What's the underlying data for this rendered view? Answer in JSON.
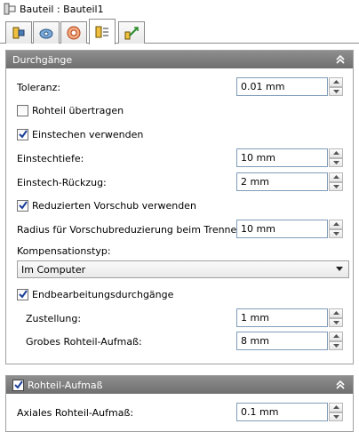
{
  "window": {
    "title": "Bauteil : Bauteil1"
  },
  "tabs": [
    {
      "icon": "tool-icon"
    },
    {
      "icon": "tool-holder-icon"
    },
    {
      "icon": "feed-speed-icon"
    },
    {
      "icon": "passes-icon",
      "active": true
    },
    {
      "icon": "linking-icon"
    }
  ],
  "passes_panel": {
    "header": "Durchgänge",
    "tolerance": {
      "label": "Toleranz:",
      "value": "0.01 mm"
    },
    "transfer_stock": {
      "label": "Rohteil übertragen",
      "checked": false
    },
    "use_plunge": {
      "label": "Einstechen verwenden",
      "checked": true
    },
    "plunge_depth": {
      "label": "Einstechtiefe:",
      "value": "10 mm"
    },
    "plunge_retract": {
      "label": "Einstech-Rückzug:",
      "value": "2 mm"
    },
    "reduced_feed": {
      "label": "Reduzierten Vorschub verwenden",
      "checked": true
    },
    "reduced_feed_radius": {
      "label": "Radius für Vorschubreduzierung beim Trennen:",
      "value": "10 mm"
    },
    "compensation": {
      "label": "Kompensationstyp:",
      "value": "Im Computer"
    },
    "finishing_passes": {
      "label": "Endbearbeitungsdurchgänge",
      "checked": true
    },
    "stepover": {
      "label": "Zustellung:",
      "value": "1 mm"
    },
    "rough_stock": {
      "label": "Grobes Rohteil-Aufmaß:",
      "value": "8 mm"
    }
  },
  "stock_panel": {
    "header": "Rohteil-Aufmaß",
    "checked": true,
    "axial_stock": {
      "label": "Axiales Rohteil-Aufmaß:",
      "value": "0.1 mm"
    }
  }
}
